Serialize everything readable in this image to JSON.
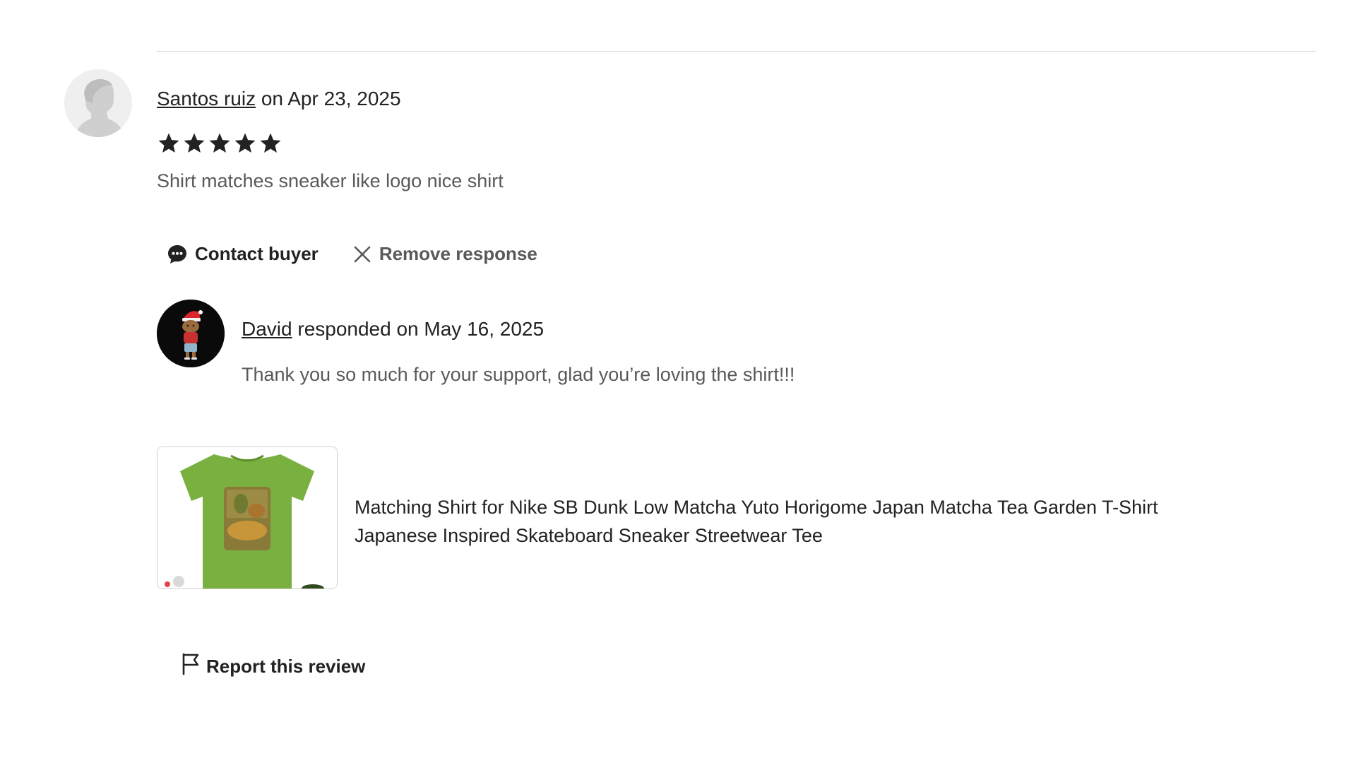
{
  "review": {
    "reviewer_name": "Santos ruiz",
    "date_text": " on Apr 23, 2025",
    "rating": 5,
    "max_rating": 5,
    "text": "Shirt matches sneaker like logo nice shirt"
  },
  "actions": {
    "contact_label": "Contact buyer",
    "remove_label": "Remove response"
  },
  "response": {
    "responder_name": "David",
    "date_text": " responded on May 16, 2025",
    "text": "Thank you so much for your support, glad you’re loving the shirt!!!"
  },
  "product": {
    "title_line1": "Matching Shirt for Nike SB Dunk Low Matcha Yuto Horigome Japan Matcha Tea Garden T-Shirt",
    "title_line2": "Japanese Inspired Skateboard Sneaker Streetwear Tee",
    "shirt_color": "#7ab03f"
  },
  "report": {
    "label": "Report this review"
  },
  "icons": {
    "contact": "chat-bubble-icon",
    "remove": "close-icon",
    "report": "flag-icon",
    "star": "star-icon"
  }
}
